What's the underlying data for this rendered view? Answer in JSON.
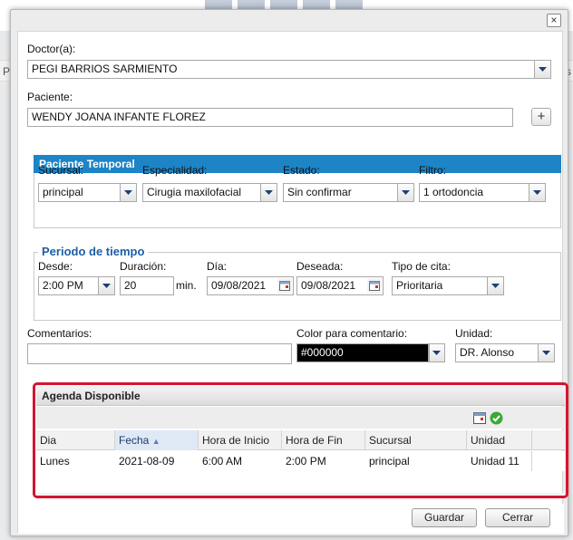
{
  "background": {
    "left_text": "Pa",
    "right_text": "irs"
  },
  "dialog": {
    "close_glyph": "×",
    "doctor": {
      "label": "Doctor(a):",
      "value": "PEGI BARRIOS SARMIENTO"
    },
    "patient": {
      "label": "Paciente:",
      "value": "WENDY JOANA INFANTE FLOREZ",
      "add_glyph": "+"
    },
    "temp_patient": {
      "title": "Paciente Temporal",
      "sucursal": {
        "label": "Sucursal:",
        "value": "principal"
      },
      "especialidad": {
        "label": "Especialidad:",
        "value": "Cirugia maxilofacial"
      },
      "estado": {
        "label": "Estado:",
        "value": "Sin confirmar"
      },
      "filtro": {
        "label": "Filtro:",
        "value": "1 ortodoncia"
      }
    },
    "period": {
      "legend": "Periodo de tiempo",
      "desde": {
        "label": "Desde:",
        "value": "2:00 PM"
      },
      "duracion": {
        "label": "Duración:",
        "value": "20",
        "unit": "min."
      },
      "dia": {
        "label": "Día:",
        "value": "09/08/2021"
      },
      "deseada": {
        "label": "Deseada:",
        "value": "09/08/2021"
      },
      "tipo": {
        "label": "Tipo de cita:",
        "value": "Prioritaria"
      }
    },
    "comments": {
      "label": "Comentarios:",
      "value": ""
    },
    "color_comment": {
      "label": "Color para comentario:",
      "value": "#000000"
    },
    "unidad": {
      "label": "Unidad:",
      "value": "DR. Alonso"
    },
    "agenda": {
      "title": "Agenda Disponible",
      "columns": [
        "Dia",
        "Fecha",
        "Hora de Inicio",
        "Hora de Fin",
        "Sucursal",
        "Unidad"
      ],
      "sort_glyph": "▲",
      "rows": [
        [
          "Lunes",
          "2021-08-09",
          "6:00 AM",
          "2:00 PM",
          "principal",
          "Unidad 11"
        ]
      ]
    },
    "buttons": {
      "save": "Guardar",
      "close": "Cerrar"
    }
  },
  "colors": {
    "accent": "#1d84c6",
    "highlight": "#d6142f",
    "legend": "#1c5fa8"
  }
}
